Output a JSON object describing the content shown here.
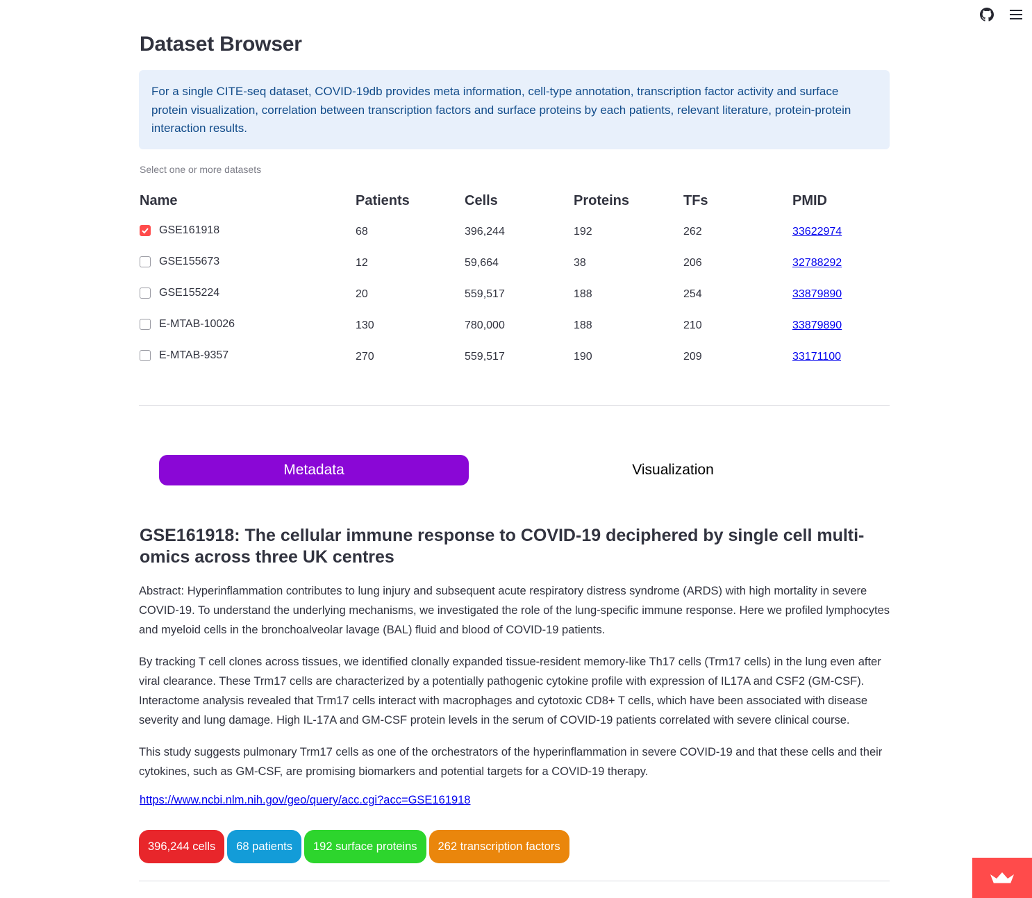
{
  "header": {
    "icons": [
      "github-icon",
      "hamburger-menu-icon"
    ]
  },
  "page": {
    "title": "Dataset Browser",
    "info": "For a single CITE-seq dataset, COVID-19db provides meta information, cell-type annotation, transcription factor activity and surface protein visualization, correlation between transcription factors and surface proteins by each patients, relevant literature, protein-protein interaction results."
  },
  "datasets": {
    "label": "Select one or more datasets",
    "columns": [
      "Name",
      "Patients",
      "Cells",
      "Proteins",
      "TFs",
      "PMID"
    ],
    "rows": [
      {
        "name": "GSE161918",
        "patients": "68",
        "cells": "396,244",
        "proteins": "192",
        "tfs": "262",
        "pmid": "33622974",
        "checked": true
      },
      {
        "name": "GSE155673",
        "patients": "12",
        "cells": "59,664",
        "proteins": "38",
        "tfs": "206",
        "pmid": "32788292",
        "checked": false
      },
      {
        "name": "GSE155224",
        "patients": "20",
        "cells": "559,517",
        "proteins": "188",
        "tfs": "254",
        "pmid": "33879890",
        "checked": false
      },
      {
        "name": "E-MTAB-10026",
        "patients": "130",
        "cells": "780,000",
        "proteins": "188",
        "tfs": "210",
        "pmid": "33879890",
        "checked": false
      },
      {
        "name": "E-MTAB-9357",
        "patients": "270",
        "cells": "559,517",
        "proteins": "190",
        "tfs": "209",
        "pmid": "33171100",
        "checked": false
      }
    ]
  },
  "tabs": {
    "metadata": "Metadata",
    "visualization": "Visualization",
    "active": "Metadata",
    "active_color": "#8a07d6"
  },
  "detail": {
    "title": "GSE161918: The cellular immune response to COVID-19 deciphered by single cell multi-omics across three UK centres",
    "paragraphs": [
      "Abstract: Hyperinflammation contributes to lung injury and subsequent acute respiratory distress syndrome (ARDS) with high mortality in severe COVID-19. To understand the underlying mechanisms, we investigated the role of the lung-specific immune response. Here we profiled lymphocytes and myeloid cells in the bronchoalveolar lavage (BAL) fluid and blood of COVID-19 patients.",
      "By tracking T cell clones across tissues, we identified clonally expanded tissue-resident memory-like Th17 cells (Trm17 cells) in the lung even after viral clearance. These Trm17 cells are characterized by a potentially pathogenic cytokine profile with expression of IL17A and CSF2 (GM-CSF). Interactome analysis revealed that Trm17 cells interact with macrophages and cytotoxic CD8+ T cells, which have been associated with disease severity and lung damage. High IL-17A and GM-CSF protein levels in the serum of COVID-19 patients correlated with severe clinical course.",
      "This study suggests pulmonary Trm17 cells as one of the orchestrators of the hyperinflammation in severe COVID-19 and that these cells and their cytokines, such as GM-CSF, are promising biomarkers and potential targets for a COVID-19 therapy."
    ],
    "link": "https://www.ncbi.nlm.nih.gov/geo/query/acc.cgi?acc=GSE161918",
    "badges": [
      {
        "text": "396,244 cells",
        "color": "#e8262b"
      },
      {
        "text": "68 patients",
        "color": "#139cd8"
      },
      {
        "text": "192 surface proteins",
        "color": "#2dd52d"
      },
      {
        "text": "262 transcription factors",
        "color": "#ea860c"
      }
    ]
  },
  "corner": {
    "icon": "streamlit-crown-icon",
    "color": "#ff4b4b"
  }
}
